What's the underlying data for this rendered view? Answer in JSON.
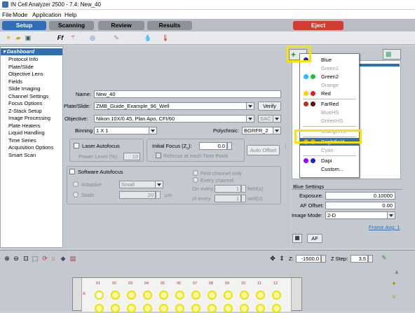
{
  "window": {
    "title": "IN Cell Analyzer 2500 - 7.4: New_40"
  },
  "menu": [
    "File",
    "Mode",
    "Application",
    "Help"
  ],
  "tabs": {
    "setup": "Setup",
    "scanning": "Scanning",
    "review": "Review",
    "results": "Results",
    "eject": "Eject"
  },
  "nav": {
    "header": "Dashboard",
    "items": [
      "Protocol Info",
      "Plate/Slide",
      "Objective Lens",
      "Fields",
      "Slide Imaging",
      "Channel Settings",
      "Focus Options",
      "Z-Stack Setup",
      "Image Processing",
      "Plate Heaters",
      "Liquid Handling",
      "Time Series",
      "Acquisition Options",
      "Smart Scan"
    ]
  },
  "form": {
    "name_label": "Name:",
    "name_value": "New_40",
    "plate_label": "Plate/Slide:",
    "plate_value": "ZMB_Guide_Example_96_Well",
    "verify": "Verify",
    "objective_label": "Objective:",
    "objective_value": "Nikon 10X/0.45, Plan Apo, CFI/60",
    "sac": "SAC",
    "binning_label": "Binning",
    "binning_value": "1 X 1",
    "polychroic_label": "Polychroic:",
    "polychroic_value": "BGRFR_2",
    "laser_af": "Laser Autofocus",
    "power_label": "Power Level (%):",
    "power_value": "10",
    "initial_focus_label": "Initial Focus (Z",
    "initial_focus_sub": "o",
    "initial_focus_end": "):",
    "initial_focus_value": "0.0",
    "refocus": "Refocus at each Time Point",
    "auto_offset": "Auto Offset",
    "software_af": "Software Autofocus",
    "adaptive": "Adaptive",
    "adaptive_value": "Small",
    "static": "Static",
    "static_value": "20",
    "um": "μm",
    "first_channel": "First channel only",
    "every_channel": "Every channel",
    "on_every": "On every",
    "on_every_value": "1",
    "fields": "field(s)",
    "of_every": "of every",
    "of_every_value": "1",
    "wells": "well(s)"
  },
  "channel_menu": {
    "items": [
      {
        "label": "Blue",
        "enabled": true,
        "dots": [
          "#2020d0"
        ]
      },
      {
        "label": "Green1",
        "enabled": false,
        "dots": []
      },
      {
        "label": "Green2",
        "enabled": true,
        "dots": [
          "#20c0ff",
          "#20c040"
        ]
      },
      {
        "label": "Orange",
        "enabled": false,
        "dots": []
      },
      {
        "label": "Red",
        "enabled": true,
        "dots": [
          "#ffd000",
          "#e02020"
        ]
      },
      {
        "label": "FarRed",
        "enabled": true,
        "dots": [
          "#c03010",
          "#601000"
        ]
      },
      {
        "label": "BlueHS",
        "enabled": false,
        "dots": []
      },
      {
        "label": "GreenHS",
        "enabled": false,
        "dots": []
      },
      {
        "label": "OrangeHS",
        "enabled": false,
        "dots": []
      },
      {
        "label": "Brightfield",
        "enabled": true,
        "dots": [
          "#f0a000",
          "#f0a000"
        ],
        "selected": true
      },
      {
        "label": "Cyan",
        "enabled": false,
        "dots": []
      },
      {
        "label": "Dapi",
        "enabled": true,
        "dots": [
          "#a000ff",
          "#2020d0"
        ]
      },
      {
        "label": "Custom...",
        "enabled": true,
        "dots": []
      }
    ]
  },
  "blue_settings": {
    "header": "Blue Settings",
    "exposure_label": "Exposure:",
    "exposure_value": "0.10000",
    "af_offset_label": "AF Offset:",
    "af_offset_value": "0.00",
    "image_mode_label": "Image Mode:",
    "image_mode_value": "2-D",
    "frame_avg": "Frame Avg: 1",
    "af": "AF"
  },
  "bottom": {
    "z_label": "Z:",
    "z_value": "-1500.0",
    "zstep_label": "Z Step:",
    "zstep_value": "3.5",
    "row_a": "A",
    "columns": [
      "01",
      "02",
      "03",
      "04",
      "05",
      "06",
      "07",
      "08",
      "09",
      "10",
      "11",
      "12"
    ]
  },
  "colors": {
    "accent": "#2f6fb5",
    "eject": "#d33c30",
    "highlight": "#ffe100"
  }
}
